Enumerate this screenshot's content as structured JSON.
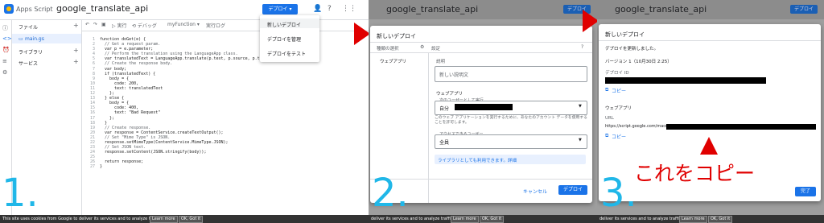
{
  "panel1": {
    "app_name": "Apps Script",
    "project_name": "google_translate_api",
    "deploy_button": "デプロイ ▾",
    "sidebar": {
      "files_label": "ファイル",
      "file_name": "main.gs",
      "libraries_label": "ライブラリ",
      "services_label": "サービス"
    },
    "toolbar": {
      "run": "▷ 実行",
      "debug": "⟲ デバッグ",
      "function_select": "myFunction ▾",
      "exec_log": "実行ログ"
    },
    "line_numbers": [
      "1",
      "2",
      "3",
      "4",
      "5",
      "6",
      "7",
      "8",
      "9",
      "10",
      "11",
      "12",
      "13",
      "14",
      "15",
      "16",
      "17",
      "18",
      "19",
      "20",
      "21",
      "22",
      "23",
      "24",
      "25",
      "26",
      "27"
    ],
    "code_lines": [
      "function doGet(e) {",
      "  // Get a request param.",
      "  var p = e.parameter;",
      "  // Perform the translation using the LanguageApp class.",
      "  var translatedText = LanguageApp.translate(p.text, p.source, p.target);",
      "  // Create the response body.",
      "  var body;",
      "  if (translatedText) {",
      "    body = {",
      "      code: 200,",
      "      text: translatedText",
      "    };",
      "  } else {",
      "    body = {",
      "      code: 400,",
      "      text: \"Bad Request\"",
      "    };",
      "  }",
      "  // Create response.",
      "  var response = ContentService.createTextOutput();",
      "  // Set \"Mime Type\" is JSON.",
      "  response.setMimeType(ContentService.MimeType.JSON);",
      "  // Set JSON text.",
      "  response.setContent(JSON.stringify(body));",
      "",
      "  return response;",
      "}"
    ],
    "deploy_menu": [
      "新しいデプロイ",
      "デプロイを管理",
      "デプロイをテスト"
    ],
    "step_number": "1."
  },
  "panel2": {
    "project_name": "google_translate_api",
    "deploy_button": "デプロイ",
    "dialog_title": "新しいデプロイ",
    "type_label": "種類の選択",
    "settings_label": "設定",
    "webapp_item": "ウェブアプリ",
    "description_label": "説明",
    "description_placeholder": "新しい説明文",
    "webapp_label": "ウェブアプリ",
    "exec_user_label": "次のユーザーとして実行",
    "exec_user_value": "自分",
    "exec_note": "このウェブ アプリケーションを実行するために、あなたのアカウント データを使用することを許可します。",
    "access_label": "アクセスできるユーザー",
    "access_value": "全員",
    "library_note": "ライブラリとしても利用できます。詳細",
    "cancel_button": "キャンセル",
    "deploy_button_dialog": "デプロイ",
    "step_number": "2."
  },
  "panel3": {
    "project_name": "google_translate_api",
    "deploy_button": "デプロイ",
    "dialog_title": "新しいデプロイ",
    "updated_message": "デプロイを更新しました。",
    "version_label": "バージョン 1（10月30日 2:25）",
    "deploy_id_label": "デプロイ ID",
    "copy_link_1": "コピー",
    "webapp_label": "ウェブアプリ",
    "url_label": "URL",
    "url_value": "https://script.google.com/macros/s/",
    "copy_link_2": "コピー",
    "copy_note": "これをコピー",
    "done_button": "完了",
    "step_number": "3."
  },
  "cookie_bar": {
    "text_full": "This site uses cookies from Google to deliver its services and to analyze traffic.",
    "text_partial": "deliver its services and to analyze traffic.",
    "learn_more": "Learn more",
    "ok": "OK, Got it"
  },
  "colors": {
    "accent_blue": "#1a73e8",
    "arrow_red": "#e00000",
    "step_cyan": "#20b7e8",
    "overlay_gray": "#9e9e9e"
  }
}
